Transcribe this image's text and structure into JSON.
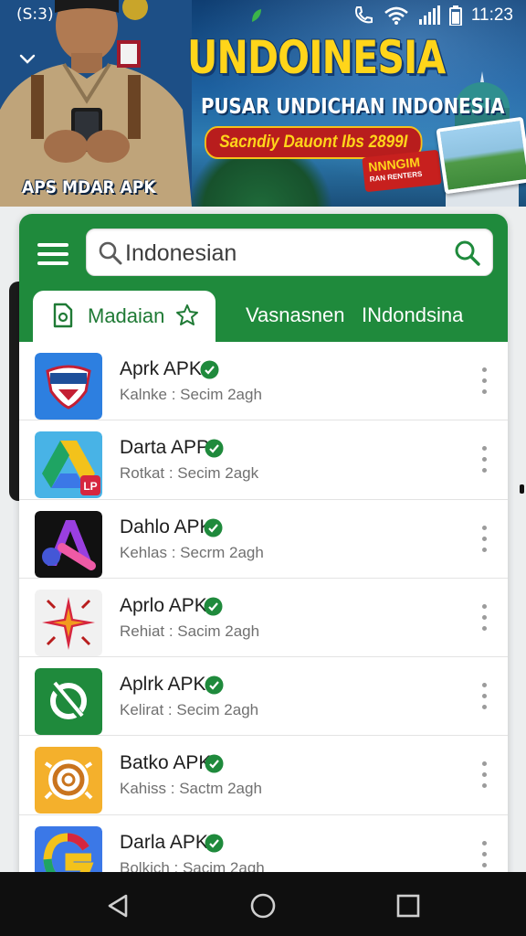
{
  "status_bar": {
    "left_text": "(S:3)",
    "time": "11:23"
  },
  "banner": {
    "title": "UNDOINESIA",
    "subtitle": "PUSAR UNDICHAN INDONESIA",
    "tagline": "Sacndiy Dauont Ibs 2899I",
    "badge_text": "NNNGIM",
    "badge_subtext": "RAN RENTERS",
    "apps_label": "APS MDAR APK",
    "colors": {
      "title": "#ffd51a",
      "pill": "#b81d1d",
      "sky": "#1c5f9e"
    }
  },
  "header": {
    "search_value": "Indonesian",
    "search_placeholder": "Search",
    "color": "#1f8a3c"
  },
  "tabs": [
    {
      "label": "Madaian",
      "icon": "document-icon",
      "badge_icon": "star-icon",
      "active": true
    },
    {
      "label": "Vasnasnen",
      "active": false
    },
    {
      "label": "INdondsina",
      "active": false
    }
  ],
  "apps": [
    {
      "name": "Aprk APK",
      "meta": "Kalnke : Secim 2agh",
      "icon": "shield-badge-icon"
    },
    {
      "name": "Darta APP",
      "meta": "Rotkat : Secim 2agk",
      "icon": "drive-triangle-icon"
    },
    {
      "name": "Dahlo APK",
      "meta": "Kehlas : Secrm 2agh",
      "icon": "letter-a-icon"
    },
    {
      "name": "Aprlo APK",
      "meta": "Rehiat : Sacim 2agh",
      "icon": "compass-star-icon"
    },
    {
      "name": "Aplrk APK",
      "meta": "Kelirat : Secim 2agh",
      "icon": "refresh-ring-icon"
    },
    {
      "name": "Batko APK",
      "meta": "Kahiss : Sactm 2agh",
      "icon": "spiral-coin-icon"
    },
    {
      "name": "Darla APK",
      "meta": "Bolkich : Sacim 2agh",
      "icon": "letter-g-icon"
    }
  ],
  "navbar": {
    "buttons": [
      "back-icon",
      "home-icon",
      "recents-icon"
    ]
  }
}
